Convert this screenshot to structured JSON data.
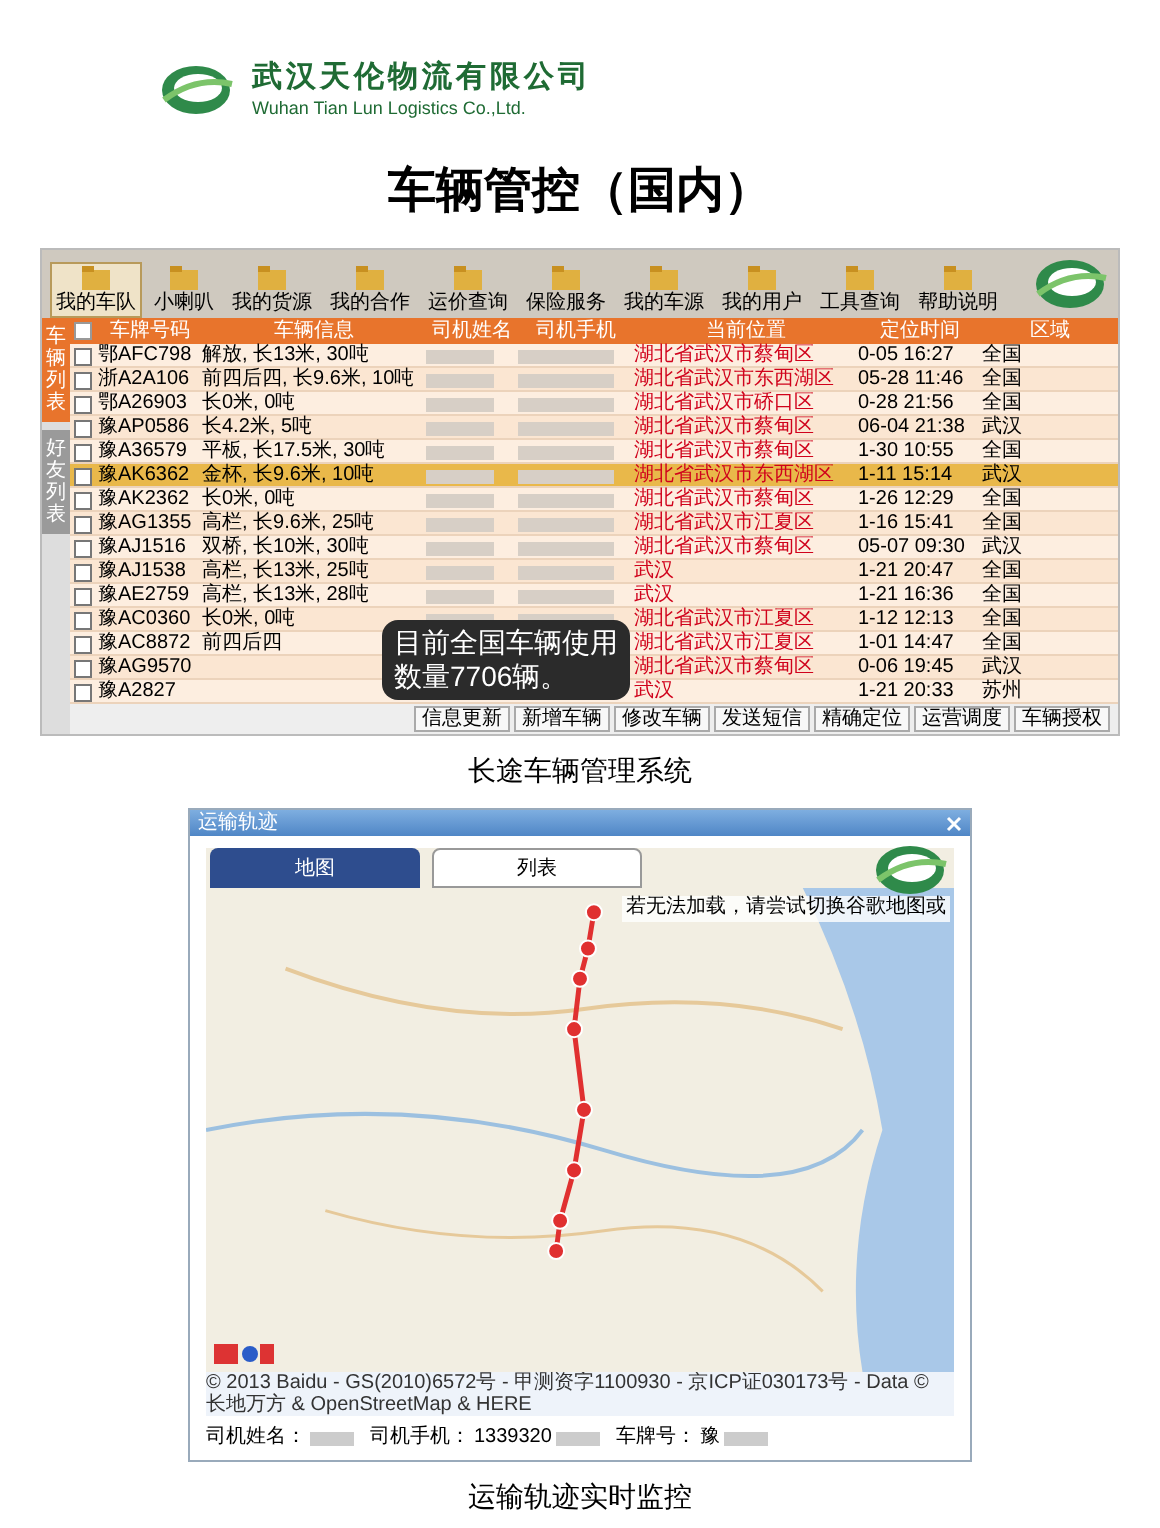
{
  "logo": {
    "name_cn": "武汉天伦物流有限公司",
    "name_en": "Wuhan Tian Lun Logistics Co.,Ltd."
  },
  "title": "车辆管控（国内）",
  "fleet_system": {
    "toolbar": [
      {
        "label": "我的车队",
        "selected": true
      },
      {
        "label": "小喇叭",
        "selected": false
      },
      {
        "label": "我的货源",
        "selected": false
      },
      {
        "label": "我的合作",
        "selected": false
      },
      {
        "label": "运价查询",
        "selected": false
      },
      {
        "label": "保险服务",
        "selected": false
      },
      {
        "label": "我的车源",
        "selected": false
      },
      {
        "label": "我的用户",
        "selected": false
      },
      {
        "label": "工具查询",
        "selected": false
      },
      {
        "label": "帮助说明",
        "selected": false
      }
    ],
    "side_tabs": [
      {
        "label": "车辆列表",
        "selected": true
      },
      {
        "label": "好友列表",
        "selected": false
      }
    ],
    "all_checked": false,
    "columns": [
      "车牌号码",
      "车辆信息",
      "司机姓名",
      "司机手机",
      "当前位置",
      "定位时间",
      "区域"
    ],
    "rows": [
      {
        "plate": "鄂AFC798",
        "info": "解放, 长13米, 30吨",
        "location": "湖北省武汉市蔡甸区",
        "time": "0-05 16:27",
        "region": "全国",
        "checked": false,
        "selected": false
      },
      {
        "plate": "浙A2A106",
        "info": "前四后四, 长9.6米, 10吨",
        "location": "湖北省武汉市东西湖区",
        "time": "05-28 11:46",
        "region": "全国",
        "checked": false,
        "selected": false
      },
      {
        "plate": "鄂A26903",
        "info": "长0米, 0吨",
        "location": "湖北省武汉市硚口区",
        "time": "0-28 21:56",
        "region": "全国",
        "checked": false,
        "selected": false
      },
      {
        "plate": "豫AP0586",
        "info": "长4.2米, 5吨",
        "location": "湖北省武汉市蔡甸区",
        "time": "06-04 21:38",
        "region": "武汉",
        "checked": false,
        "selected": false
      },
      {
        "plate": "豫A36579",
        "info": "平板, 长17.5米, 30吨",
        "location": "湖北省武汉市蔡甸区",
        "time": "1-30 10:55",
        "region": "全国",
        "checked": false,
        "selected": false
      },
      {
        "plate": "豫AK6362",
        "info": "金杯, 长9.6米, 10吨",
        "location": "湖北省武汉市东西湖区",
        "time": "1-11 15:14",
        "region": "武汉",
        "checked": false,
        "selected": true
      },
      {
        "plate": "豫AK2362",
        "info": "长0米, 0吨",
        "location": "湖北省武汉市蔡甸区",
        "time": "1-26 12:29",
        "region": "全国",
        "checked": false,
        "selected": false
      },
      {
        "plate": "豫AG1355",
        "info": "高栏, 长9.6米, 25吨",
        "location": "湖北省武汉市江夏区",
        "time": "1-16 15:41",
        "region": "全国",
        "checked": false,
        "selected": false
      },
      {
        "plate": "豫AJ1516",
        "info": "双桥, 长10米, 30吨",
        "location": "湖北省武汉市蔡甸区",
        "time": "05-07 09:30",
        "region": "武汉",
        "checked": false,
        "selected": false
      },
      {
        "plate": "豫AJ1538",
        "info": "高栏, 长13米, 25吨",
        "location": "武汉",
        "time": "1-21 20:47",
        "region": "全国",
        "checked": false,
        "selected": false
      },
      {
        "plate": "豫AE2759",
        "info": "高栏, 长13米, 28吨",
        "location": "武汉",
        "time": "1-21 16:36",
        "region": "全国",
        "checked": false,
        "selected": false
      },
      {
        "plate": "豫AC0360",
        "info": "长0米, 0吨",
        "location": "湖北省武汉市江夏区",
        "time": "1-12 12:13",
        "region": "全国",
        "checked": false,
        "selected": false
      },
      {
        "plate": "豫AC8872",
        "info": "前四后四",
        "location": "湖北省武汉市江夏区",
        "time": "1-01 14:47",
        "region": "全国",
        "checked": false,
        "selected": false
      },
      {
        "plate": "豫AG9570",
        "location": "湖北省武汉市蔡甸区",
        "time": "0-06 19:45",
        "region": "武汉",
        "checked": false,
        "selected": false
      },
      {
        "plate": "豫A2827",
        "location": "武汉",
        "time": "1-21 20:33",
        "region": "苏州",
        "checked": false,
        "selected": false
      }
    ],
    "buttons": [
      "信息更新",
      "新增车辆",
      "修改车辆",
      "发送短信",
      "精确定位",
      "运营调度",
      "车辆授权"
    ],
    "callout": "目前全国车辆使用数量7706辆。"
  },
  "fleet_caption": "长途车辆管理系统",
  "track_window": {
    "title": "运输轨迹",
    "tabs": [
      {
        "label": "地图",
        "selected": true
      },
      {
        "label": "列表",
        "selected": false
      }
    ],
    "notice": "若无法加载，请尝试切换谷歌地图或",
    "copyright": "© 2013 Baidu - GS(2010)6572号 - 甲测资字1100930 - 京ICP证030173号 - Data © 长地万方 & OpenStreetMap & HERE",
    "driver_fields": [
      {
        "label": "司机姓名："
      },
      {
        "label": "司机手机：",
        "value": "1339320"
      },
      {
        "label": "车牌号：",
        "value": "豫"
      }
    ]
  },
  "track_caption": "运输轨迹实时监控"
}
